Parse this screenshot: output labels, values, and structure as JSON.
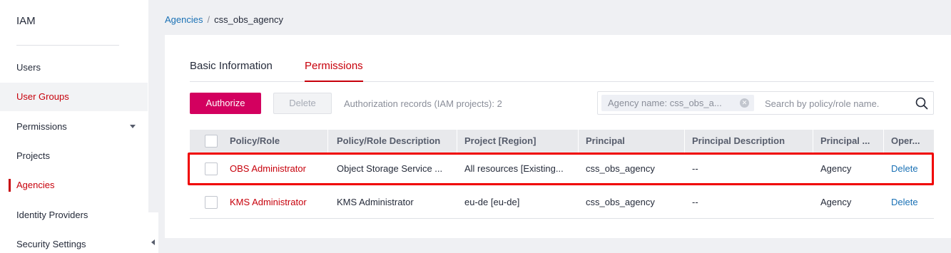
{
  "sidebar": {
    "title": "IAM",
    "items": [
      {
        "label": "Users"
      },
      {
        "label": "User Groups"
      },
      {
        "label": "Permissions"
      },
      {
        "label": "Projects"
      },
      {
        "label": "Agencies"
      },
      {
        "label": "Identity Providers"
      },
      {
        "label": "Security Settings"
      }
    ]
  },
  "breadcrumb": {
    "parent": "Agencies",
    "separator": "/",
    "current": "css_obs_agency"
  },
  "tabs": [
    {
      "label": "Basic Information"
    },
    {
      "label": "Permissions"
    }
  ],
  "toolbar": {
    "authorize_label": "Authorize",
    "delete_label": "Delete",
    "records_text": "Authorization records (IAM projects): 2"
  },
  "search": {
    "tag_text": "Agency name: css_obs_a...",
    "placeholder": "Search by policy/role name."
  },
  "table": {
    "headers": [
      "Policy/Role",
      "Policy/Role Description",
      "Project [Region]",
      "Principal",
      "Principal Description",
      "Principal ...",
      "Oper..."
    ],
    "rows": [
      {
        "policy": "OBS Administrator",
        "description": "Object Storage Service ...",
        "project": "All resources [Existing...",
        "principal": "css_obs_agency",
        "principal_description": "--",
        "principal_type": "Agency",
        "operation": "Delete"
      },
      {
        "policy": "KMS Administrator",
        "description": "KMS Administrator",
        "project": "eu-de [eu-de]",
        "principal": "css_obs_agency",
        "principal_description": "--",
        "principal_type": "Agency",
        "operation": "Delete"
      }
    ]
  },
  "colors": {
    "accent": "#c7000b",
    "primary_button": "#d3005f",
    "link": "#1a71b5",
    "highlight": "#f00000"
  }
}
